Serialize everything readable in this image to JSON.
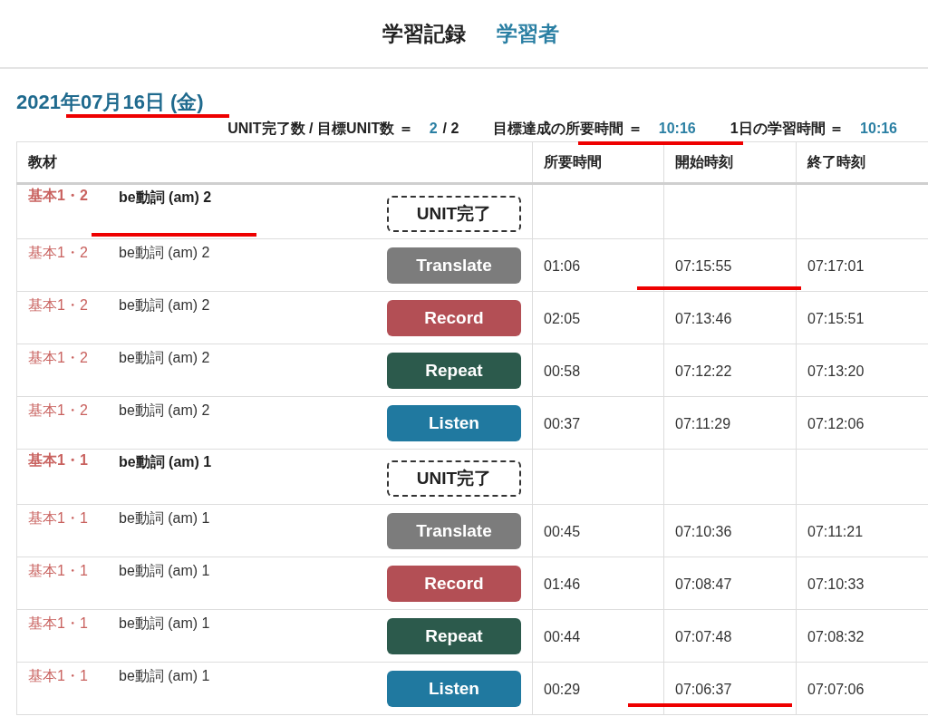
{
  "header": {
    "title": "学習記録",
    "link": "学習者"
  },
  "date": "2021年07月16日 (金)",
  "summary": [
    {
      "label": "UNIT完了数 / 目標UNIT数 ＝",
      "value": "2",
      "suffix": "/ 2"
    },
    {
      "label": "目標達成の所要時間 ＝",
      "value": "10:16"
    },
    {
      "label": "1日の学習時間 ＝",
      "value": "10:16"
    }
  ],
  "table": {
    "columns": [
      "教材",
      "所要時間",
      "開始時刻",
      "終了時刻"
    ],
    "rows": [
      {
        "kind": "unit",
        "course": "基本1・2",
        "title": "be動詞 (am) 2",
        "button": "UNIT完了"
      },
      {
        "kind": "translate",
        "course": "基本1・2",
        "title": "be動詞 (am) 2",
        "button": "Translate",
        "duration": "01:06",
        "start": "07:15:55",
        "end": "07:17:01"
      },
      {
        "kind": "record",
        "course": "基本1・2",
        "title": "be動詞 (am) 2",
        "button": "Record",
        "duration": "02:05",
        "start": "07:13:46",
        "end": "07:15:51"
      },
      {
        "kind": "repeat",
        "course": "基本1・2",
        "title": "be動詞 (am) 2",
        "button": "Repeat",
        "duration": "00:58",
        "start": "07:12:22",
        "end": "07:13:20"
      },
      {
        "kind": "listen",
        "course": "基本1・2",
        "title": "be動詞 (am) 2",
        "button": "Listen",
        "duration": "00:37",
        "start": "07:11:29",
        "end": "07:12:06"
      },
      {
        "kind": "unit",
        "course": "基本1・1",
        "title": "be動詞 (am) 1",
        "button": "UNIT完了"
      },
      {
        "kind": "translate",
        "course": "基本1・1",
        "title": "be動詞 (am) 1",
        "button": "Translate",
        "duration": "00:45",
        "start": "07:10:36",
        "end": "07:11:21"
      },
      {
        "kind": "record",
        "course": "基本1・1",
        "title": "be動詞 (am) 1",
        "button": "Record",
        "duration": "01:46",
        "start": "07:08:47",
        "end": "07:10:33"
      },
      {
        "kind": "repeat",
        "course": "基本1・1",
        "title": "be動詞 (am) 1",
        "button": "Repeat",
        "duration": "00:44",
        "start": "07:07:48",
        "end": "07:08:32"
      },
      {
        "kind": "listen",
        "course": "基本1・1",
        "title": "be動詞 (am) 1",
        "button": "Listen",
        "duration": "00:29",
        "start": "07:06:37",
        "end": "07:07:06"
      }
    ]
  }
}
